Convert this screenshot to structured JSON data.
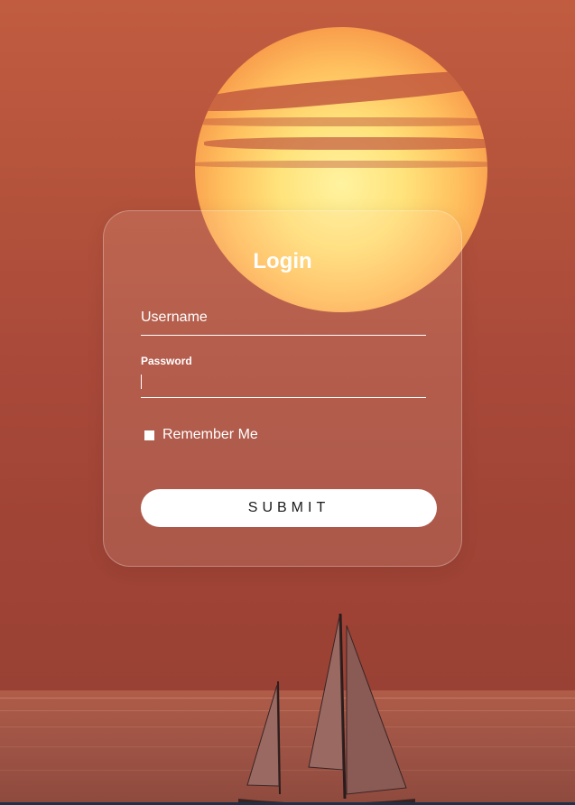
{
  "login_form": {
    "title": "Login",
    "username": {
      "label": "Username",
      "value": ""
    },
    "password": {
      "label": "Password",
      "value": ""
    },
    "remember_me": {
      "label": "Remember Me",
      "checked": false
    },
    "submit_label": "SUBMIT"
  },
  "colors": {
    "background": "#a44b37",
    "sun": "#ffe27a",
    "card_text": "#ffffff",
    "button_bg": "#ffffff",
    "button_text": "#1a1a1a"
  },
  "background_image": {
    "icon": "sunset-sailboat-photo"
  }
}
